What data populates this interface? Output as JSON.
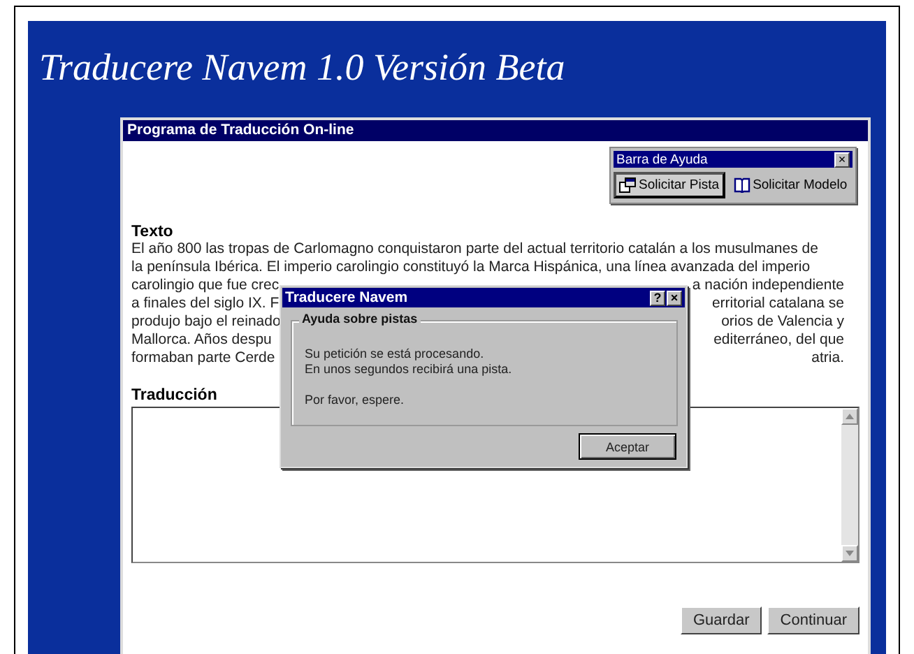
{
  "page_title": "Traducere Navem 1.0 Versión Beta",
  "window": {
    "title": "Programa de Traducción On-line"
  },
  "help_bar": {
    "title": "Barra de Ayuda",
    "close": "×",
    "buttons": [
      {
        "label": "Solicitar Pista",
        "kind": "hint",
        "pressed": true
      },
      {
        "label": "Solicitar Modelo",
        "kind": "model",
        "pressed": false
      }
    ]
  },
  "source": {
    "label": "Texto",
    "lines": [
      {
        "left": "El año 800 las tropas de Carlomagno conquistaron parte del actual territorio catalán a los musulmanes de"
      },
      {
        "left": "la península Ibérica. El imperio carolingio constituyó la Marca Hispánica, una línea avanzada del imperio"
      },
      {
        "left": "carolingio que fue crec",
        "right": "a nación independiente"
      },
      {
        "left": "a finales del siglo IX. F",
        "right": "erritorial catalana se"
      },
      {
        "left": "produjo bajo el reinado",
        "right": "orios de Valencia y"
      },
      {
        "left": "Mallorca. Años despu",
        "right": "editerráneo, del que"
      },
      {
        "left": "formaban parte Cerde",
        "right": "atria."
      }
    ]
  },
  "translation": {
    "label": "Traducción"
  },
  "buttons": [
    "Guardar",
    "Continuar"
  ],
  "dialog": {
    "title": "Traducere Navem",
    "help": "?",
    "close": "×",
    "group": "Ayuda sobre pistas",
    "lines": [
      "Su petición se está procesando.",
      "En unos segundos recibirá una pista."
    ],
    "note": "Por favor, espere.",
    "button": "Aceptar"
  }
}
